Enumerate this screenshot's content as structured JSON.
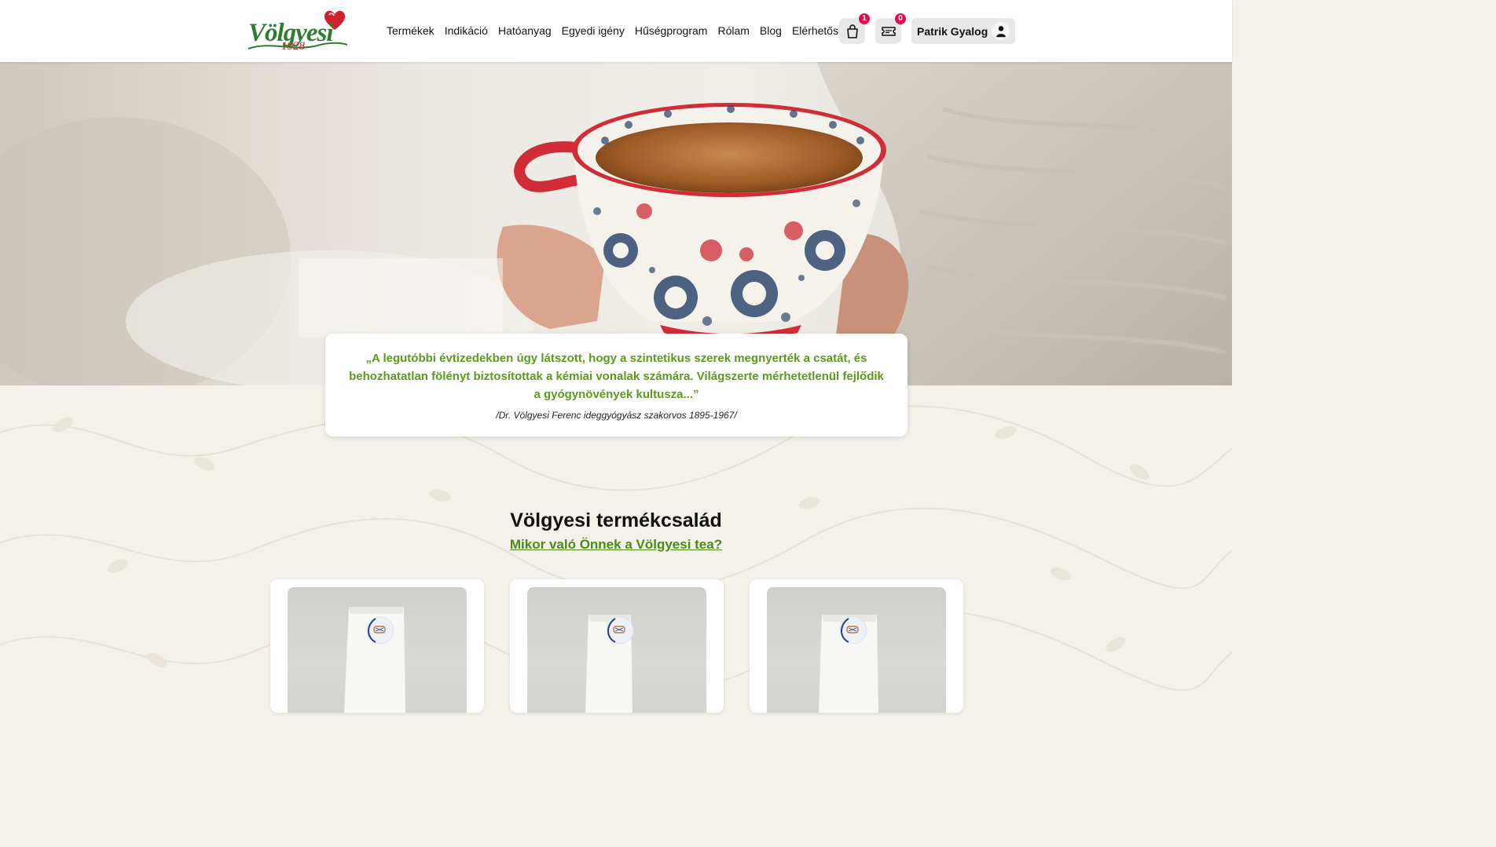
{
  "header": {
    "logo_word": "Völgyesi",
    "logo_year": "1928",
    "nav": [
      "Termékek",
      "Indikáció",
      "Hatóanyag",
      "Egyedi igény",
      "Hűségprogram",
      "Rólam",
      "Blog",
      "Elérhetőség"
    ],
    "cart_count": "1",
    "voucher_count": "0",
    "user_name": "Patrik Gyalog"
  },
  "hero": {
    "quote": "„A legutóbbi évtizedekben úgy látszott, hogy a szintetikus szerek megnyerték a csatát, és behozhatatlan fölényt biztosítottak a kémiai vonalak számára. Világszerte mérhetetlenül fejlődik a gyógynövények kultusza...”",
    "author": "/Dr. Völgyesi Ferenc ideggyógyász szakorvos 1895-1967/"
  },
  "section": {
    "title": "Völgyesi termékcsalád",
    "link": "Mikor való Önnek a Völgyesi tea?"
  },
  "colors": {
    "brand_green": "#2f7d32",
    "accent_green": "#5b9a1e",
    "brand_red": "#c9212b",
    "badge": "#e30d4b"
  }
}
